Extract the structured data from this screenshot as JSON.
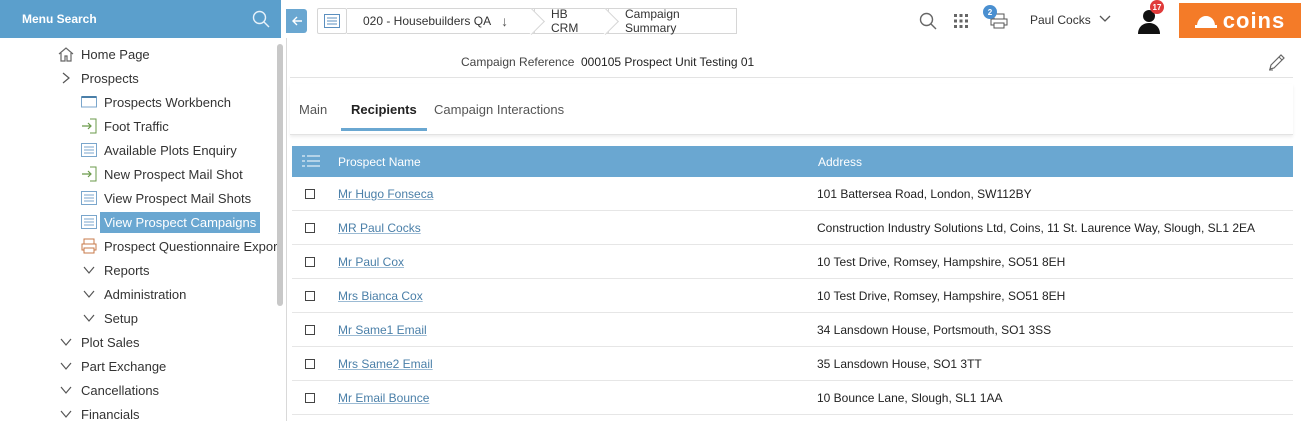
{
  "sidebar": {
    "search_label": "Menu Search",
    "items": [
      {
        "label": "Home Page",
        "icon": "home-icon",
        "level": 1
      },
      {
        "label": "Prospects",
        "icon": "chevron-right-icon",
        "level": 1
      },
      {
        "label": "Prospects Workbench",
        "icon": "workbench-icon",
        "level": 2
      },
      {
        "label": "Foot Traffic",
        "icon": "enter-icon",
        "level": 2
      },
      {
        "label": "Available Plots Enquiry",
        "icon": "list-icon",
        "level": 2
      },
      {
        "label": "New Prospect Mail Shot",
        "icon": "enter-icon",
        "level": 2
      },
      {
        "label": "View Prospect Mail Shots",
        "icon": "list-icon",
        "level": 2
      },
      {
        "label": "View Prospect Campaigns",
        "icon": "list-icon",
        "level": 2,
        "active": true
      },
      {
        "label": "Prospect Questionnaire Expor",
        "icon": "printer-icon",
        "level": 2
      },
      {
        "label": "Reports",
        "icon": "chevron-down-icon",
        "level": 2
      },
      {
        "label": "Administration",
        "icon": "chevron-down-icon",
        "level": 2
      },
      {
        "label": "Setup",
        "icon": "chevron-down-icon",
        "level": 2
      },
      {
        "label": "Plot Sales",
        "icon": "chevron-down-icon",
        "level": 1
      },
      {
        "label": "Part Exchange",
        "icon": "chevron-down-icon",
        "level": 1
      },
      {
        "label": "Cancellations",
        "icon": "chevron-down-icon",
        "level": 1
      },
      {
        "label": "Financials",
        "icon": "chevron-down-icon",
        "level": 1
      }
    ]
  },
  "topbar": {
    "breadcrumbs": [
      "020 - Housebuilders QA",
      "HB CRM",
      "Campaign Summary"
    ],
    "print_badge": "2",
    "user_name": "Paul Cocks",
    "notifications_badge": "17",
    "logo_text": "coins"
  },
  "reference": {
    "label": "Campaign Reference",
    "value": "000105 Prospect Unit Testing 01"
  },
  "tabs": [
    {
      "label": "Main",
      "active": false
    },
    {
      "label": "Recipients",
      "active": true
    },
    {
      "label": "Campaign Interactions",
      "active": false
    }
  ],
  "grid": {
    "columns": [
      "Prospect Name",
      "Address"
    ],
    "rows": [
      {
        "name": "Mr Hugo Fonseca",
        "address": "101 Battersea Road, London, SW112BY"
      },
      {
        "name": "MR Paul Cocks",
        "address": "Construction Industry Solutions Ltd, Coins, 11 St. Laurence Way, Slough, SL1 2EA"
      },
      {
        "name": "Mr Paul Cox",
        "address": "10 Test Drive, Romsey, Hampshire, SO51 8EH"
      },
      {
        "name": "Mrs Bianca Cox",
        "address": "10 Test Drive, Romsey, Hampshire, SO51 8EH"
      },
      {
        "name": "Mr Same1 Email",
        "address": "34 Lansdown House, Portsmouth, SO1 3SS"
      },
      {
        "name": "Mrs Same2 Email",
        "address": "35 Lansdown House, SO1 3TT"
      },
      {
        "name": "Mr Email Bounce",
        "address": "10 Bounce Lane, Slough, SL1 1AA"
      }
    ]
  },
  "colors": {
    "accent": "#6aa7d1",
    "menu_search_bg": "#5b9fcc",
    "logo_bg": "#f47b28",
    "link": "#4a7fa8"
  }
}
